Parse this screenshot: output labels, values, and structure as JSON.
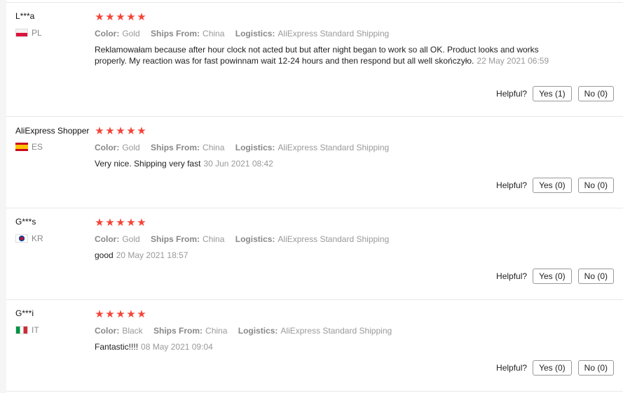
{
  "labels": {
    "color": "Color:",
    "ships_from": "Ships From:",
    "logistics": "Logistics:",
    "helpful": "Helpful?"
  },
  "rating_glyph": "★",
  "reviews": [
    {
      "user": "L***a",
      "country": "PL",
      "flag": "flag-pl",
      "stars": 5,
      "color": "Gold",
      "ships_from": "China",
      "logistics": "AliExpress Standard Shipping",
      "text": "Reklamowałam because after hour clock not acted but but after night began to work so all OK. Product looks and works properly. My reaction was for fast powinnam wait 12-24 hours and then respond but all well skończyło.",
      "date": "22 May 2021 06:59",
      "yes": "Yes (1)",
      "no": "No (0)"
    },
    {
      "user": "AliExpress Shopper",
      "country": "ES",
      "flag": "flag-es",
      "stars": 5,
      "color": "Gold",
      "ships_from": "China",
      "logistics": "AliExpress Standard Shipping",
      "text": "Very nice. Shipping very fast",
      "date": "30 Jun 2021 08:42",
      "yes": "Yes (0)",
      "no": "No (0)"
    },
    {
      "user": "G***s",
      "country": "KR",
      "flag": "flag-kr",
      "stars": 5,
      "color": "Gold",
      "ships_from": "China",
      "logistics": "AliExpress Standard Shipping",
      "text": "good",
      "date": "20 May 2021 18:57",
      "yes": "Yes (0)",
      "no": "No (0)"
    },
    {
      "user": "G***i",
      "country": "IT",
      "flag": "flag-it",
      "stars": 5,
      "color": "Black",
      "ships_from": "China",
      "logistics": "AliExpress Standard Shipping",
      "text": "Fantastic!!!!",
      "date": "08 May 2021 09:04",
      "yes": "Yes (0)",
      "no": "No (0)"
    }
  ]
}
